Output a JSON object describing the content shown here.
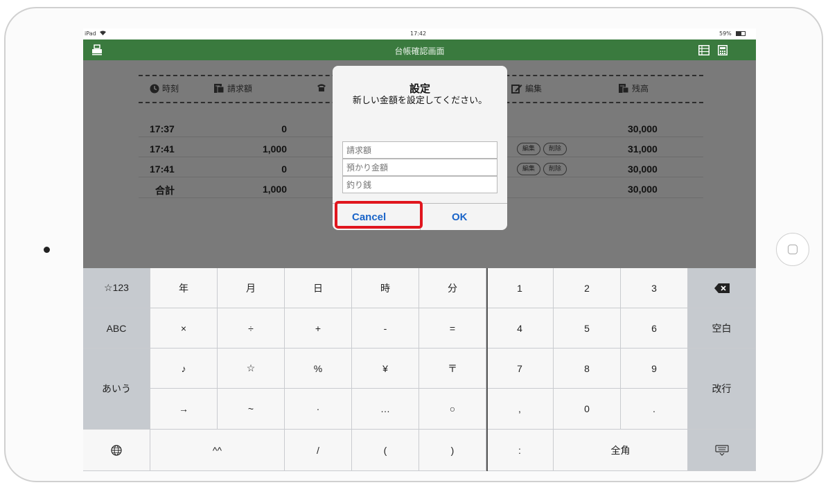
{
  "status_bar": {
    "device": "iPad",
    "time": "17:42",
    "battery": "59%"
  },
  "nav": {
    "title": "台帳確認画面",
    "left_icon": "printer-icon",
    "right_icons": [
      "list-icon",
      "calculator-icon"
    ]
  },
  "table": {
    "headers": [
      {
        "icon": "clock-icon",
        "label": "時刻"
      },
      {
        "icon": "invoice-icon",
        "label": "請求額"
      },
      {
        "icon": "edit-icon",
        "label": "編集"
      },
      {
        "icon": "balance-icon",
        "label": "残高"
      }
    ],
    "rows": [
      {
        "time": "17:37",
        "amount": "0",
        "balance": "30,000",
        "edit": "",
        "delete": ""
      },
      {
        "time": "17:41",
        "amount": "1,000",
        "balance": "31,000",
        "edit": "編集",
        "delete": "削除"
      },
      {
        "time": "17:41",
        "amount": "0",
        "balance": "30,000",
        "edit": "編集",
        "delete": "削除"
      }
    ],
    "total": {
      "label": "合計",
      "amount": "1,000",
      "balance": "30,000"
    }
  },
  "dialog": {
    "title": "設定",
    "message": "新しい金額を設定してください。",
    "inputs": [
      {
        "placeholder": "請求額"
      },
      {
        "placeholder": "預かり金額"
      },
      {
        "placeholder": "釣り銭"
      }
    ],
    "cancel_label": "Cancel",
    "ok_label": "OK",
    "highlight_color": "#e0161e"
  },
  "keyboard": {
    "rows": [
      [
        "☆123",
        "年",
        "月",
        "日",
        "時",
        "分",
        "1",
        "2",
        "3",
        "⌫"
      ],
      [
        "ABC",
        "×",
        "÷",
        "+",
        "-",
        "=",
        "4",
        "5",
        "6",
        "空白"
      ],
      [
        "あいう",
        "♪",
        "☆",
        "%",
        "¥",
        "〒",
        "7",
        "8",
        "9",
        "改行"
      ],
      [
        "",
        "→",
        "~",
        "·",
        "…",
        "○",
        ",",
        "0",
        ".",
        ""
      ],
      [
        "globe-icon",
        "^^",
        "",
        "/",
        "(",
        ")",
        ":",
        "全角",
        "",
        "hide-keyboard-icon"
      ]
    ]
  },
  "colors": {
    "nav_green": "#3a7a3e",
    "ok_blue": "#1a64c8",
    "highlight_red": "#e0161e"
  }
}
